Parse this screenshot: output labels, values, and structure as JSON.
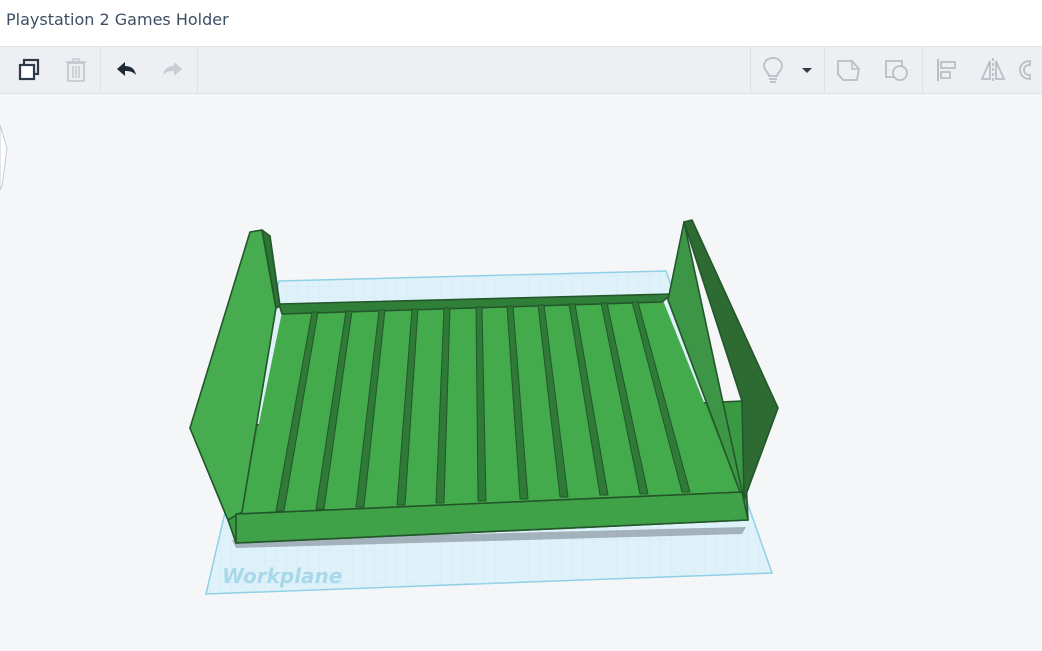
{
  "window": {
    "title": "Playstation 2 Games Holder"
  },
  "toolbar": {
    "left": [
      {
        "name": "copy-button",
        "icon": "copy-icon",
        "enabled": true
      },
      {
        "name": "delete-button",
        "icon": "trash-icon",
        "enabled": false
      },
      {
        "name": "undo-button",
        "icon": "undo-icon",
        "enabled": true
      },
      {
        "name": "redo-button",
        "icon": "redo-icon",
        "enabled": false
      }
    ],
    "right": [
      {
        "name": "light-button",
        "icon": "lightbulb-icon"
      },
      {
        "name": "light-dropdown",
        "icon": "caret-down-icon"
      },
      {
        "name": "solid-button",
        "icon": "shape-solid-icon"
      },
      {
        "name": "hole-button",
        "icon": "shape-hole-icon"
      },
      {
        "name": "align-button",
        "icon": "align-icon"
      },
      {
        "name": "mirror-button",
        "icon": "mirror-icon"
      },
      {
        "name": "group-button",
        "icon": "group-icon"
      }
    ]
  },
  "scene": {
    "workplane_label": "Workplane",
    "model_color": "#3e9b45",
    "workplane_color": "#dff2fa"
  }
}
